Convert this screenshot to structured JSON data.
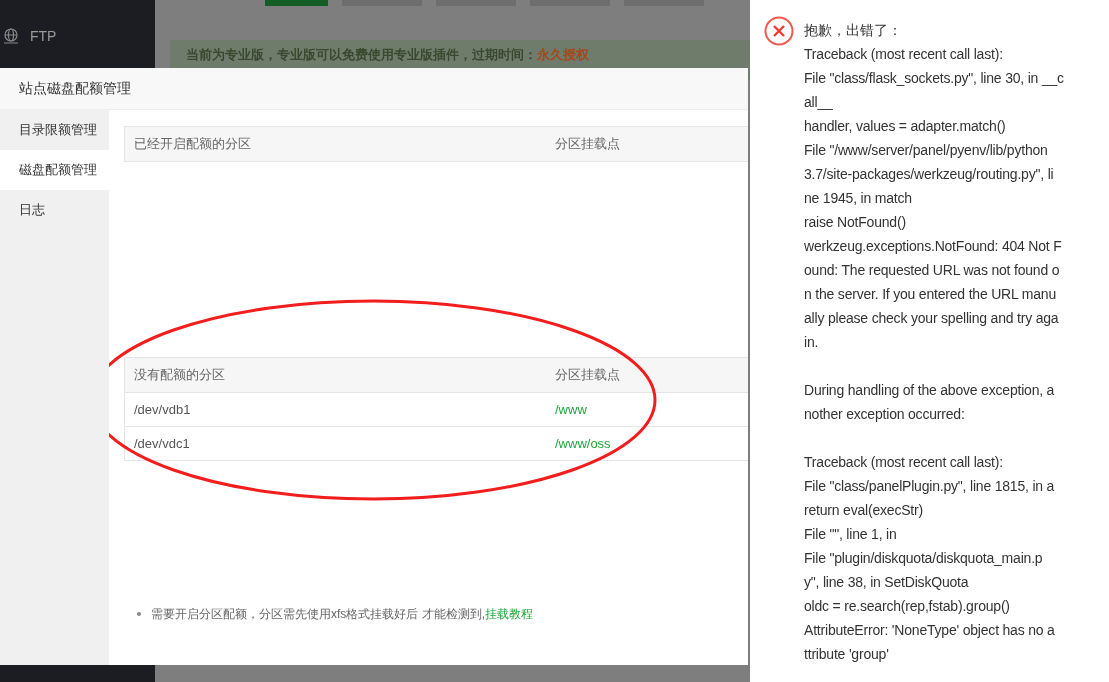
{
  "sidebar": {
    "items": [
      {
        "label": "FTP"
      }
    ]
  },
  "background": {
    "tabs": [
      {
        "selected": true
      },
      {
        "selected": false
      },
      {
        "selected": false
      },
      {
        "selected": false
      },
      {
        "selected": false
      }
    ],
    "banner": {
      "text": "当前为专业版，专业版可以免费使用专业版插件，过期时间：",
      "highlight": "永久授权"
    }
  },
  "dialog": {
    "title": "站点磁盘配额管理",
    "menu": [
      {
        "label": "目录限额管理",
        "selected": false
      },
      {
        "label": "磁盘配额管理",
        "selected": true
      },
      {
        "label": "日志",
        "selected": false
      }
    ],
    "enabled_table": {
      "columns": [
        "已经开启配额的分区",
        "分区挂载点"
      ]
    },
    "disabled_table": {
      "columns": [
        "没有配额的分区",
        "分区挂载点"
      ],
      "rows": [
        [
          "/dev/vdb1",
          "/www"
        ],
        [
          "/dev/vdc1",
          "/www/oss"
        ]
      ]
    },
    "note": {
      "text": "需要开启分区配额，分区需先使用xfs格式挂载好后 才能检测到,",
      "link": "挂载教程"
    }
  },
  "error": {
    "title": "抱歉，出错了：",
    "paragraphs": [
      [
        "Traceback (most recent call last):",
        "File \"class/flask_sockets.py\", line 30, in __c",
        "all__",
        "handler, values = adapter.match()",
        "File \"/www/server/panel/pyenv/lib/python",
        "3.7/site-packages/werkzeug/routing.py\", li",
        "ne 1945, in match",
        "raise NotFound()",
        "werkzeug.exceptions.NotFound: 404 Not F",
        "ound: The requested URL was not found o",
        "n the server. If you entered the URL manu",
        "ally please check your spelling and try aga",
        "in."
      ],
      [
        "During handling of the above exception, a",
        "nother exception occurred:"
      ],
      [
        "Traceback (most recent call last):",
        "File \"class/panelPlugin.py\", line 1815, in a",
        "return eval(execStr)",
        "File \"\", line 1, in",
        "File \"plugin/diskquota/diskquota_main.p",
        "y\", line 38, in SetDiskQuota",
        "oldc = re.search(rep,fstab).group()",
        "AttributeError: 'NoneType' object has no a",
        "ttribute 'group'"
      ]
    ]
  }
}
